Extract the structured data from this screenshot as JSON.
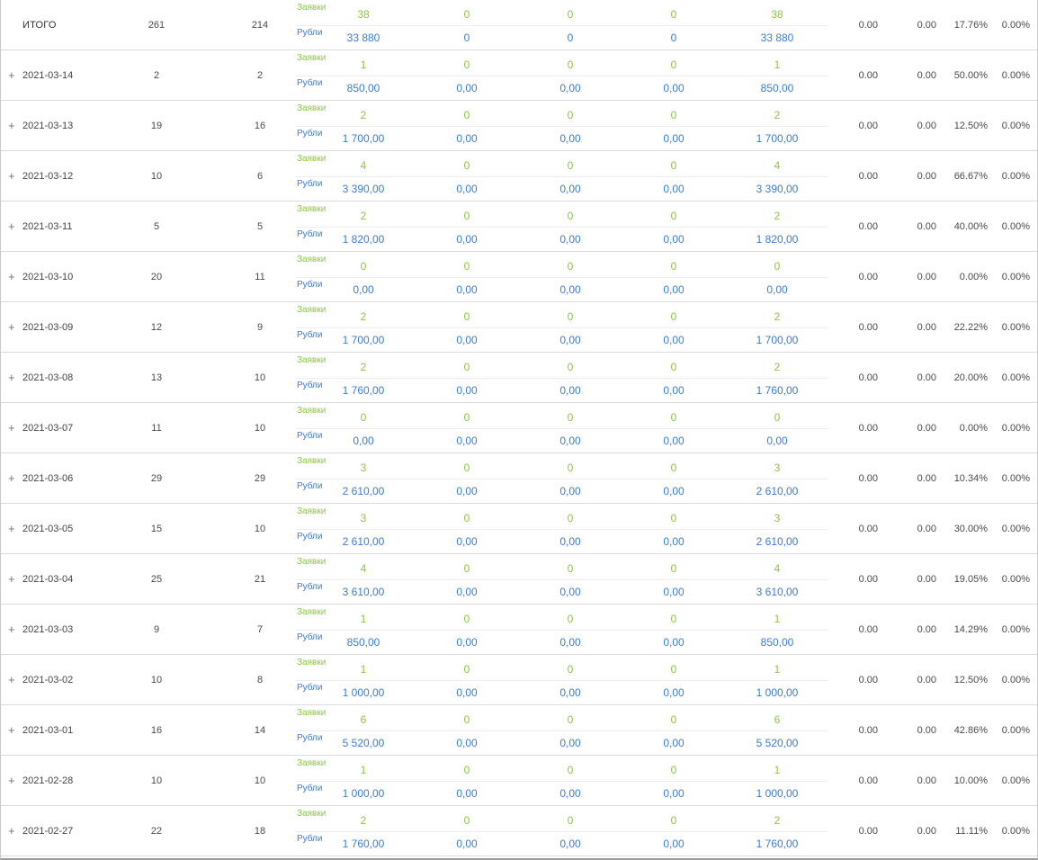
{
  "labels": {
    "orders": "Заявки",
    "rubles": "Рубли",
    "expand": "+"
  },
  "colors": {
    "orders": "#8cc63f",
    "rubles": "#3b7dd8"
  },
  "rows": [
    {
      "date": "ИТОГО",
      "a": "261",
      "b": "214",
      "orders": [
        "38",
        "0",
        "0",
        "0",
        "38"
      ],
      "rubles": [
        "33 880",
        "0",
        "0",
        "0",
        "33 880"
      ],
      "r1": "0.00",
      "r2": "0.00",
      "r3": "17.76%",
      "r4": "0.00%",
      "total": true
    },
    {
      "date": "2021-03-14",
      "a": "2",
      "b": "2",
      "orders": [
        "1",
        "0",
        "0",
        "0",
        "1"
      ],
      "rubles": [
        "850,00",
        "0,00",
        "0,00",
        "0,00",
        "850,00"
      ],
      "r1": "0.00",
      "r2": "0.00",
      "r3": "50.00%",
      "r4": "0.00%"
    },
    {
      "date": "2021-03-13",
      "a": "19",
      "b": "16",
      "orders": [
        "2",
        "0",
        "0",
        "0",
        "2"
      ],
      "rubles": [
        "1 700,00",
        "0,00",
        "0,00",
        "0,00",
        "1 700,00"
      ],
      "r1": "0.00",
      "r2": "0.00",
      "r3": "12.50%",
      "r4": "0.00%"
    },
    {
      "date": "2021-03-12",
      "a": "10",
      "b": "6",
      "orders": [
        "4",
        "0",
        "0",
        "0",
        "4"
      ],
      "rubles": [
        "3 390,00",
        "0,00",
        "0,00",
        "0,00",
        "3 390,00"
      ],
      "r1": "0.00",
      "r2": "0.00",
      "r3": "66.67%",
      "r4": "0.00%"
    },
    {
      "date": "2021-03-11",
      "a": "5",
      "b": "5",
      "orders": [
        "2",
        "0",
        "0",
        "0",
        "2"
      ],
      "rubles": [
        "1 820,00",
        "0,00",
        "0,00",
        "0,00",
        "1 820,00"
      ],
      "r1": "0.00",
      "r2": "0.00",
      "r3": "40.00%",
      "r4": "0.00%"
    },
    {
      "date": "2021-03-10",
      "a": "20",
      "b": "11",
      "orders": [
        "0",
        "0",
        "0",
        "0",
        "0"
      ],
      "rubles": [
        "0,00",
        "0,00",
        "0,00",
        "0,00",
        "0,00"
      ],
      "r1": "0.00",
      "r2": "0.00",
      "r3": "0.00%",
      "r4": "0.00%"
    },
    {
      "date": "2021-03-09",
      "a": "12",
      "b": "9",
      "orders": [
        "2",
        "0",
        "0",
        "0",
        "2"
      ],
      "rubles": [
        "1 700,00",
        "0,00",
        "0,00",
        "0,00",
        "1 700,00"
      ],
      "r1": "0.00",
      "r2": "0.00",
      "r3": "22.22%",
      "r4": "0.00%"
    },
    {
      "date": "2021-03-08",
      "a": "13",
      "b": "10",
      "orders": [
        "2",
        "0",
        "0",
        "0",
        "2"
      ],
      "rubles": [
        "1 760,00",
        "0,00",
        "0,00",
        "0,00",
        "1 760,00"
      ],
      "r1": "0.00",
      "r2": "0.00",
      "r3": "20.00%",
      "r4": "0.00%"
    },
    {
      "date": "2021-03-07",
      "a": "11",
      "b": "10",
      "orders": [
        "0",
        "0",
        "0",
        "0",
        "0"
      ],
      "rubles": [
        "0,00",
        "0,00",
        "0,00",
        "0,00",
        "0,00"
      ],
      "r1": "0.00",
      "r2": "0.00",
      "r3": "0.00%",
      "r4": "0.00%"
    },
    {
      "date": "2021-03-06",
      "a": "29",
      "b": "29",
      "orders": [
        "3",
        "0",
        "0",
        "0",
        "3"
      ],
      "rubles": [
        "2 610,00",
        "0,00",
        "0,00",
        "0,00",
        "2 610,00"
      ],
      "r1": "0.00",
      "r2": "0.00",
      "r3": "10.34%",
      "r4": "0.00%"
    },
    {
      "date": "2021-03-05",
      "a": "15",
      "b": "10",
      "orders": [
        "3",
        "0",
        "0",
        "0",
        "3"
      ],
      "rubles": [
        "2 610,00",
        "0,00",
        "0,00",
        "0,00",
        "2 610,00"
      ],
      "r1": "0.00",
      "r2": "0.00",
      "r3": "30.00%",
      "r4": "0.00%"
    },
    {
      "date": "2021-03-04",
      "a": "25",
      "b": "21",
      "orders": [
        "4",
        "0",
        "0",
        "0",
        "4"
      ],
      "rubles": [
        "3 610,00",
        "0,00",
        "0,00",
        "0,00",
        "3 610,00"
      ],
      "r1": "0.00",
      "r2": "0.00",
      "r3": "19.05%",
      "r4": "0.00%"
    },
    {
      "date": "2021-03-03",
      "a": "9",
      "b": "7",
      "orders": [
        "1",
        "0",
        "0",
        "0",
        "1"
      ],
      "rubles": [
        "850,00",
        "0,00",
        "0,00",
        "0,00",
        "850,00"
      ],
      "r1": "0.00",
      "r2": "0.00",
      "r3": "14.29%",
      "r4": "0.00%"
    },
    {
      "date": "2021-03-02",
      "a": "10",
      "b": "8",
      "orders": [
        "1",
        "0",
        "0",
        "0",
        "1"
      ],
      "rubles": [
        "1 000,00",
        "0,00",
        "0,00",
        "0,00",
        "1 000,00"
      ],
      "r1": "0.00",
      "r2": "0.00",
      "r3": "12.50%",
      "r4": "0.00%"
    },
    {
      "date": "2021-03-01",
      "a": "16",
      "b": "14",
      "orders": [
        "6",
        "0",
        "0",
        "0",
        "6"
      ],
      "rubles": [
        "5 520,00",
        "0,00",
        "0,00",
        "0,00",
        "5 520,00"
      ],
      "r1": "0.00",
      "r2": "0.00",
      "r3": "42.86%",
      "r4": "0.00%"
    },
    {
      "date": "2021-02-28",
      "a": "10",
      "b": "10",
      "orders": [
        "1",
        "0",
        "0",
        "0",
        "1"
      ],
      "rubles": [
        "1 000,00",
        "0,00",
        "0,00",
        "0,00",
        "1 000,00"
      ],
      "r1": "0.00",
      "r2": "0.00",
      "r3": "10.00%",
      "r4": "0.00%"
    },
    {
      "date": "2021-02-27",
      "a": "22",
      "b": "18",
      "orders": [
        "2",
        "0",
        "0",
        "0",
        "2"
      ],
      "rubles": [
        "1 760,00",
        "0,00",
        "0,00",
        "0,00",
        "1 760,00"
      ],
      "r1": "0.00",
      "r2": "0.00",
      "r3": "11.11%",
      "r4": "0.00%"
    }
  ]
}
